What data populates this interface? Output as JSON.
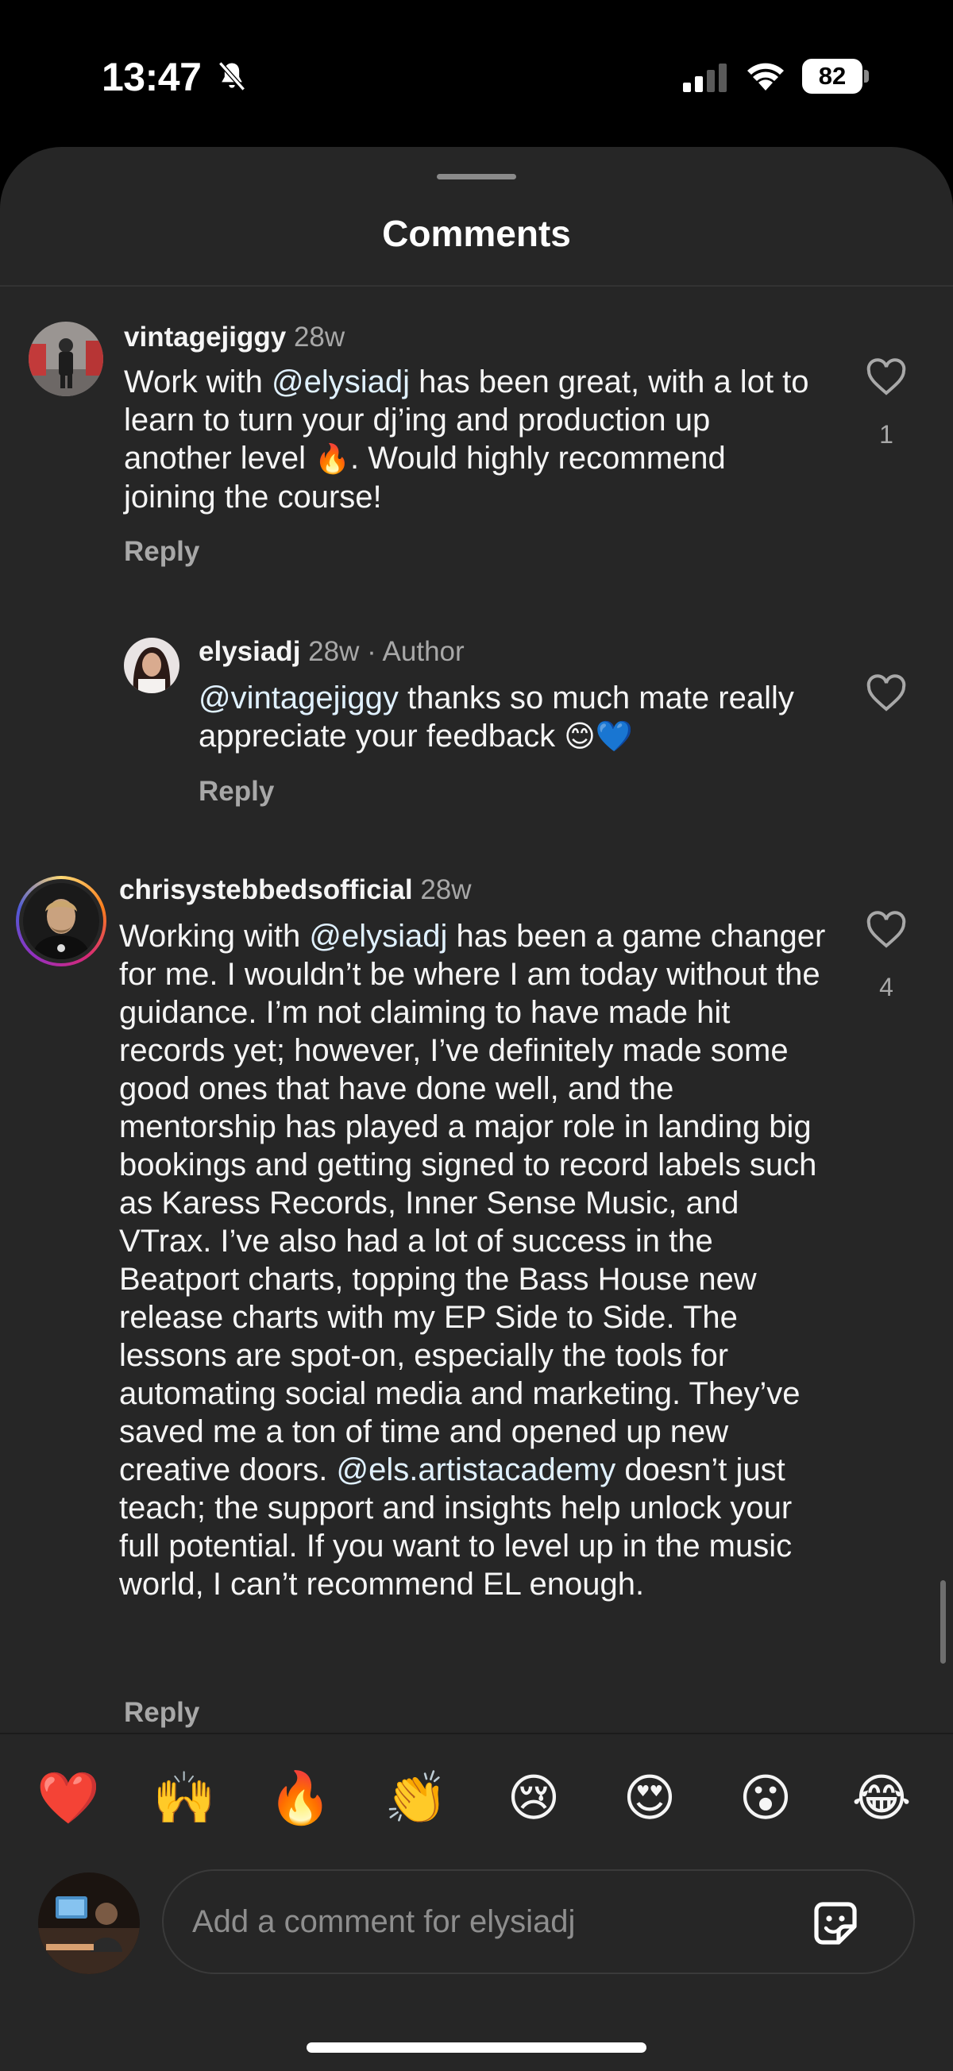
{
  "status_bar": {
    "time": "13:47",
    "battery_level": "82",
    "icons": [
      "bell-slash-icon",
      "cellular-signal-icon",
      "wifi-icon",
      "battery-icon"
    ]
  },
  "sheet": {
    "title": "Comments"
  },
  "comments": [
    {
      "username": "vintagejiggy",
      "age": "28w",
      "text_parts": [
        "Work with ",
        "@elysiadj",
        " has been great, with a lot to learn to turn your dj’ing and production up another level ",
        "🔥",
        ". Would highly recommend joining the course!"
      ],
      "reply_label": "Reply",
      "likes": "1"
    },
    {
      "username": "elysiadj",
      "age": "28w",
      "author_badge": "· Author",
      "text_parts": [
        "@vintagejiggy",
        " thanks so much mate really appreciate your feedback ",
        "😊💙"
      ],
      "reply_label": "Reply",
      "likes": ""
    },
    {
      "username": "chrisystebbedsofficial",
      "age": "28w",
      "text_parts": [
        "Working with ",
        "@elysiadj",
        " has been a game changer for me. I wouldn’t be where I am today without the guidance. I’m not claiming to have made hit records yet; however, I’ve definitely made some good ones that have done well, and the mentorship has played a major role in landing big bookings and getting signed to record labels such as Karess Records, Inner Sense Music, and VTrax. I’ve also had a lot of success in the Beatport charts, topping the Bass House new release charts with my EP Side to Side. The lessons are spot-on, especially the tools for automating social media and marketing. They’ve saved me a ton of time and opened up new creative doors. ",
        "@els.artistacademy",
        " doesn’t just teach; the support and insights help unlock your full potential. If you want to level up in the music world, I can’t recommend EL enough."
      ],
      "reply_label": "Reply",
      "likes": "4"
    }
  ],
  "emoji_bar": [
    "❤️",
    "🙌",
    "🔥",
    "👏",
    "😢",
    "😍",
    "😮",
    "😂"
  ],
  "composer": {
    "placeholder": "Add a comment for elysiadj",
    "sticker_icon": "sticker-icon"
  },
  "colors": {
    "sheet_bg": "#262626",
    "mention": "#e0f1ff",
    "secondary_text": "#a8a8a8"
  }
}
